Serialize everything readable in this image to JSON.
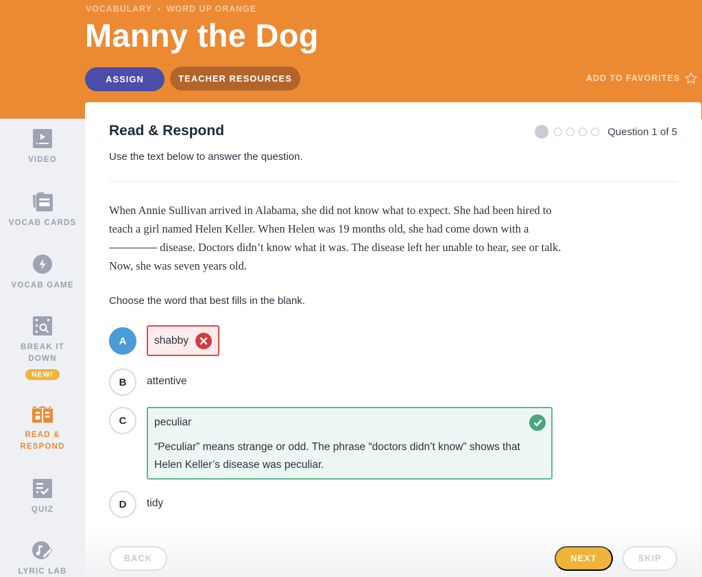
{
  "header": {
    "breadcrumb": [
      "VOCABULARY",
      "WORD UP ORANGE"
    ],
    "breadcrumb_separator": "›",
    "title": "Manny the Dog",
    "assign_label": "ASSIGN",
    "teacher_resources_label": "TEACHER RESOURCES",
    "favorites_label": "ADD TO FAVORITES",
    "favorites_icon": "star-outline-icon"
  },
  "sidebar": {
    "items": [
      {
        "label": "VIDEO",
        "icon": "video-icon",
        "active": false
      },
      {
        "label": "VOCAB CARDS",
        "icon": "cards-icon",
        "active": false
      },
      {
        "label": "VOCAB GAME",
        "icon": "lightning-icon",
        "active": false
      },
      {
        "label_line1": "BREAK IT",
        "label_line2": "DOWN",
        "icon": "magnify-grid-icon",
        "badge": "NEW!",
        "active": false
      },
      {
        "label_line1": "READ &",
        "label_line2": "RESPOND",
        "icon": "book-icon",
        "active": true
      },
      {
        "label": "QUIZ",
        "icon": "quiz-icon",
        "active": false
      },
      {
        "label": "LYRIC LAB",
        "icon": "music-pencil-icon",
        "active": false
      }
    ]
  },
  "main": {
    "title": "Read & Respond",
    "subtitle": "Use the text below to answer the question.",
    "progress": {
      "current": 1,
      "total": 5,
      "label": "Question 1 of 5"
    },
    "passage_part1": "When Annie Sullivan arrived in Alabama, she did not know what to expect. She had been hired to teach a girl named Helen Keller. When Helen was 19 months old, she had come down with a",
    "passage_part2": "disease. Doctors didn’t know what it was. The disease left her unable to hear, see or talk. Now, she was seven years old.",
    "prompt": "Choose the word that best fills in the blank.",
    "options": [
      {
        "letter": "A",
        "text": "shabby",
        "state": "selected-wrong"
      },
      {
        "letter": "B",
        "text": "attentive",
        "state": "default"
      },
      {
        "letter": "C",
        "text": "peculiar",
        "state": "correct",
        "explanation": "“Peculiar” means strange or odd. The phrase “doctors didn’t know” shows that Helen Keller’s disease was peculiar."
      },
      {
        "letter": "D",
        "text": "tidy",
        "state": "default"
      }
    ],
    "colors": {
      "wrong": "#e0474a",
      "correct": "#5bb993",
      "selected": "#4a9bd6",
      "accent": "#ec8a33"
    }
  },
  "footer": {
    "back_label": "BACK",
    "next_label": "NEXT",
    "skip_label": "SKIP"
  }
}
